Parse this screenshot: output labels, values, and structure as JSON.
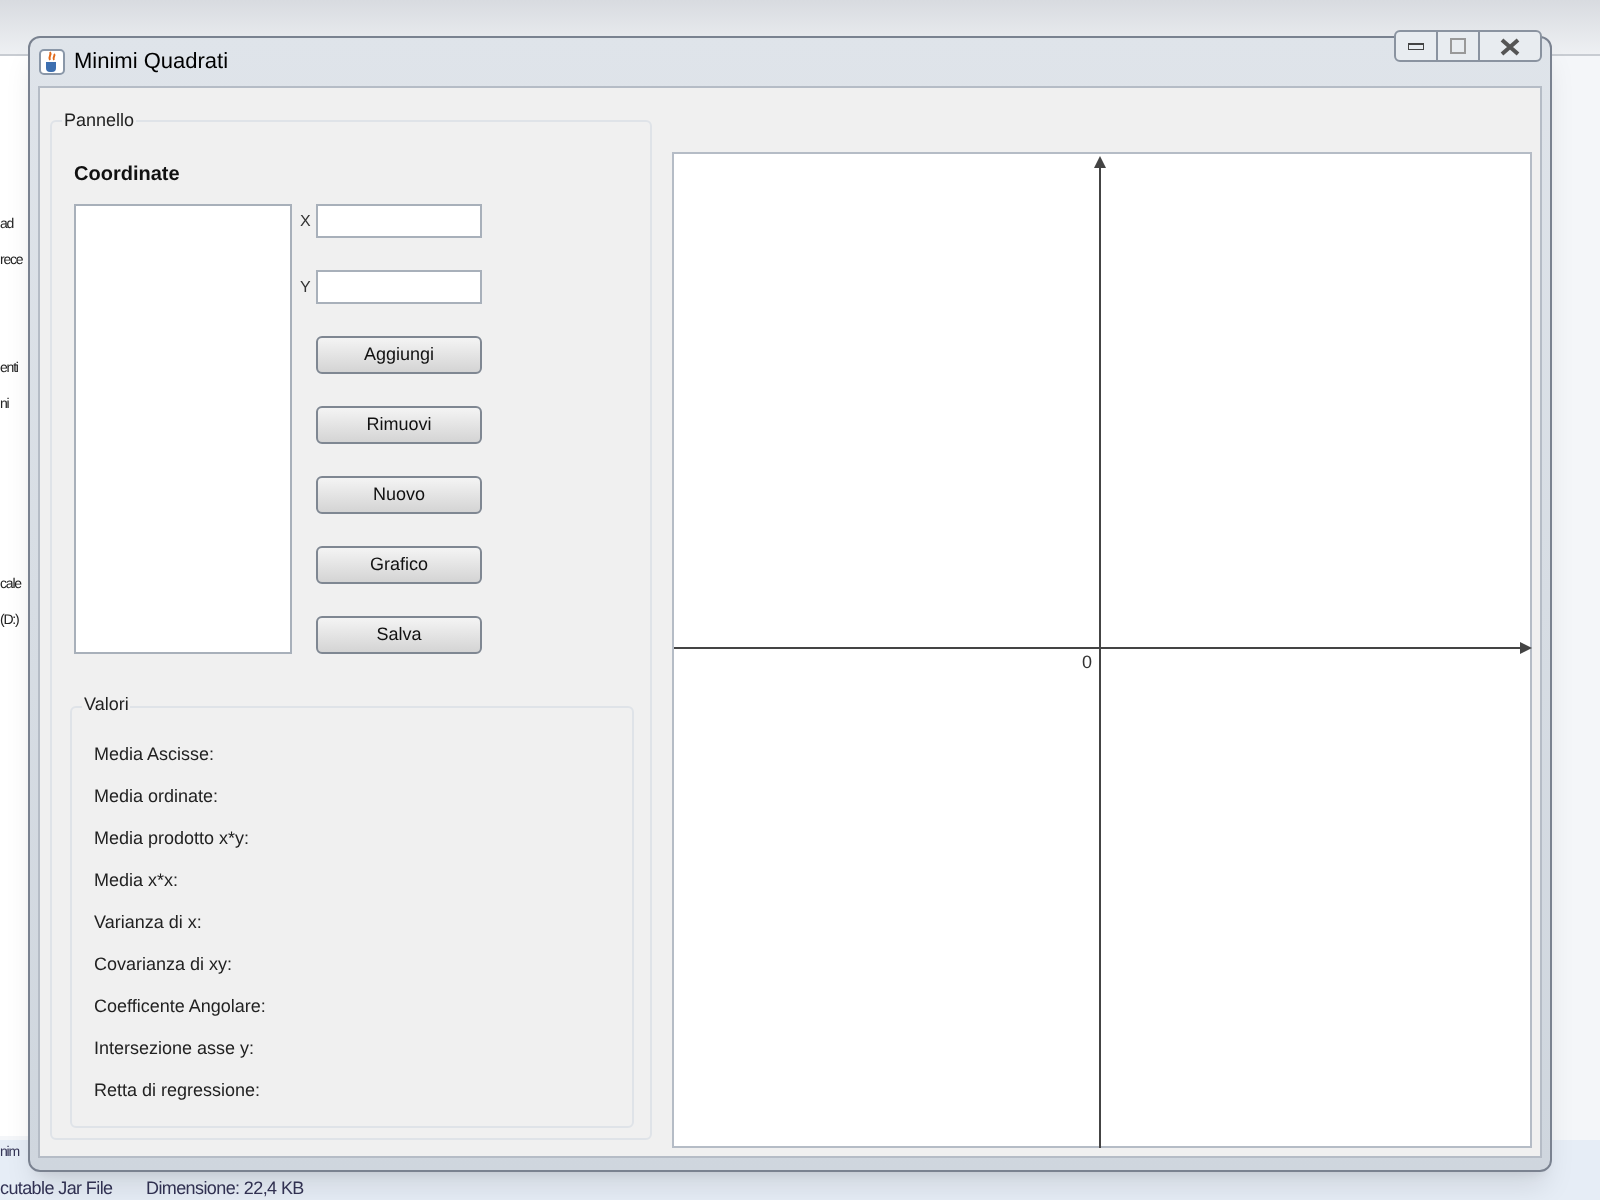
{
  "background": {
    "sidebar_fragments": [
      "ad",
      "rece",
      "enti",
      "ni",
      "cale",
      "(D:)"
    ],
    "status": [
      "nim",
      "cutable Jar File",
      "Dimensione: 22,4 KB"
    ]
  },
  "window": {
    "title": "Minimi Quadrati"
  },
  "panel": {
    "title": "Pannello",
    "heading": "Coordinate",
    "fields": [
      {
        "label": "X"
      },
      {
        "label": "Y"
      }
    ],
    "buttons": [
      "Aggiungi",
      "Rimuovi",
      "Nuovo",
      "Grafico",
      "Salva"
    ],
    "values_title": "Valori",
    "values": [
      "Media Ascisse:",
      "Media ordinate:",
      "Media prodotto x*y:",
      "Media x*x:",
      "Varianza di x:",
      "Covarianza di xy:",
      "Coefficente Angolare:",
      "Intersezione asse y:",
      "Retta di regressione:"
    ]
  },
  "plot": {
    "origin_label": "0"
  }
}
